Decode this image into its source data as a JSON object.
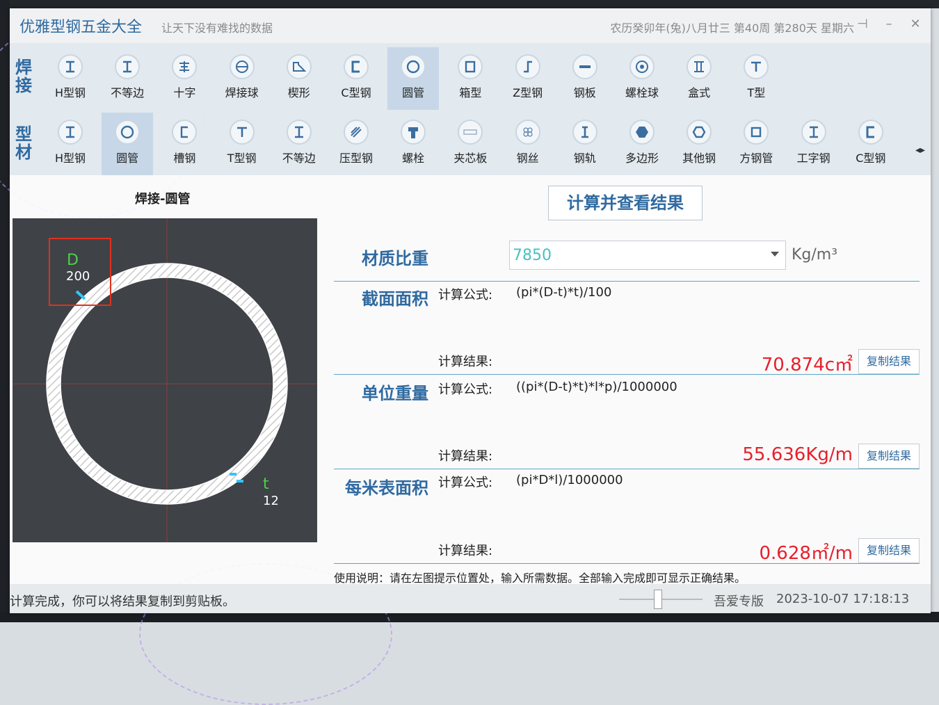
{
  "titlebar": {
    "app_title": "优雅型钢五金大全",
    "slogan": "让天下没有难找的数据",
    "date_info": "农历癸卯年(兔)八月廿三 第40周 第280天 星期六",
    "pin_glyph": "⊣",
    "minimize_glyph": "–",
    "close_glyph": "✕"
  },
  "toolbar": {
    "row1_label": "焊接",
    "row2_label": "型材",
    "row1": [
      {
        "label": "H型钢",
        "icon": "h-beam-icon"
      },
      {
        "label": "不等边",
        "icon": "unequal-angle-icon"
      },
      {
        "label": "十字",
        "icon": "cross-section-icon"
      },
      {
        "label": "焊接球",
        "icon": "welded-ball-icon"
      },
      {
        "label": "楔形",
        "icon": "wedge-icon"
      },
      {
        "label": "C型钢",
        "icon": "c-channel-icon"
      },
      {
        "label": "圆管",
        "icon": "round-pipe-icon"
      },
      {
        "label": "箱型",
        "icon": "box-section-icon"
      },
      {
        "label": "Z型钢",
        "icon": "z-section-icon"
      },
      {
        "label": "钢板",
        "icon": "steel-plate-icon"
      },
      {
        "label": "螺栓球",
        "icon": "bolt-ball-icon"
      },
      {
        "label": "盒式",
        "icon": "box-type-icon"
      },
      {
        "label": "T型",
        "icon": "t-section-icon"
      }
    ],
    "row2": [
      {
        "label": "H型钢",
        "icon": "h-beam-icon"
      },
      {
        "label": "圆管",
        "icon": "round-pipe-icon"
      },
      {
        "label": "槽钢",
        "icon": "channel-icon"
      },
      {
        "label": "T型钢",
        "icon": "t-section-icon"
      },
      {
        "label": "不等边",
        "icon": "unequal-angle-icon"
      },
      {
        "label": "压型钢",
        "icon": "profiled-steel-icon"
      },
      {
        "label": "螺栓",
        "icon": "bolt-icon"
      },
      {
        "label": "夹芯板",
        "icon": "sandwich-panel-icon"
      },
      {
        "label": "钢丝",
        "icon": "steel-wire-icon"
      },
      {
        "label": "钢轨",
        "icon": "rail-icon"
      },
      {
        "label": "多边形",
        "icon": "polygon-icon"
      },
      {
        "label": "其他钢",
        "icon": "other-steel-icon"
      },
      {
        "label": "方钢管",
        "icon": "square-tube-icon"
      },
      {
        "label": "工字钢",
        "icon": "i-beam-icon"
      },
      {
        "label": "C型钢",
        "icon": "c-channel-icon"
      }
    ],
    "scroll_arrows": "◂▸"
  },
  "diagram": {
    "caption": "焊接-圆管",
    "d_label": "D",
    "d_value": "200",
    "t_label": "t",
    "t_value": "12"
  },
  "calc": {
    "button_label": "计算并查看结果",
    "density_title": "材质比重",
    "density_value": "7850",
    "density_unit": "Kg/m³",
    "formula_label": "计算公式:",
    "result_label": "计算结果:",
    "copy_label": "复制结果",
    "sections": [
      {
        "title": "截面面积",
        "formula": "(pi*(D-t)*t)/100",
        "result": "70.874c㎡"
      },
      {
        "title": "单位重量",
        "formula": "((pi*(D-t)*t)*l*p)/1000000",
        "result": "55.636Kg/m"
      },
      {
        "title": "每米表面积",
        "formula": "(pi*D*l)/1000000",
        "result": "0.628㎡/m"
      }
    ],
    "usage": "使用说明：请在左图提示位置处，输入所需数据。全部输入完成即可显示正确结果。"
  },
  "statusbar": {
    "message": "计算完成，你可以将结果复制到剪贴板。",
    "edition": "吾爱专版",
    "datetime": "2023-10-07 17:18:13"
  },
  "colors": {
    "accent": "#2f6aa0",
    "result_red": "#e8202a",
    "density_text": "#48c0c0",
    "dimension_green": "#4bd14b",
    "highlight_red": "#e0311d"
  }
}
